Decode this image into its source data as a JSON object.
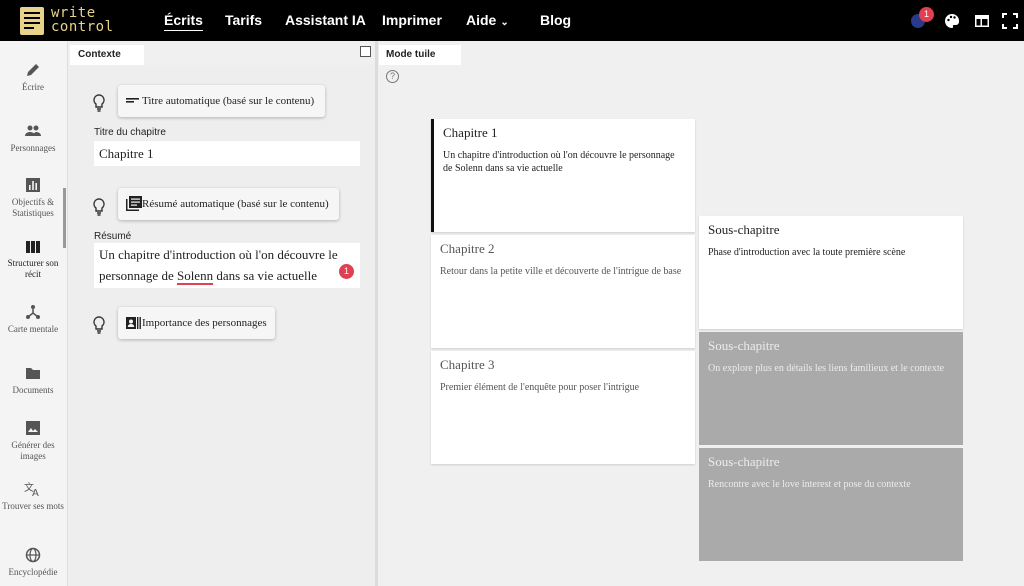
{
  "app": {
    "logo_line1": "write",
    "logo_line2": "control",
    "notification_count": "1"
  },
  "nav": [
    {
      "label": "Écrits"
    },
    {
      "label": "Tarifs"
    },
    {
      "label": "Assistant IA"
    },
    {
      "label": "Imprimer"
    },
    {
      "label": "Aide",
      "chevron": "chevron-down-icon"
    },
    {
      "label": "Blog"
    }
  ],
  "sidebar": {
    "items": [
      {
        "label": "Écrire",
        "icon": "pencil-icon"
      },
      {
        "label": "Personnages",
        "icon": "people-icon"
      },
      {
        "label": "Objectifs & Statistiques",
        "icon": "bar-chart-icon"
      },
      {
        "label": "Structurer son récit",
        "icon": "columns-icon"
      },
      {
        "label": "Carte mentale",
        "icon": "mind-map-icon"
      },
      {
        "label": "Documents",
        "icon": "folder-icon"
      },
      {
        "label": "Générer des images",
        "icon": "image-icon"
      },
      {
        "label": "Trouver ses mots",
        "icon": "translate-icon"
      },
      {
        "label": "Encyclopédie",
        "icon": "globe-icon"
      }
    ]
  },
  "context": {
    "tab_label": "Contexte",
    "auto_title_button": "Titre automatique (basé sur le contenu)",
    "title_label": "Titre du chapitre",
    "title_value": "Chapitre 1",
    "auto_summary_button": "Résumé automatique (basé sur le contenu)",
    "summary_label": "Résumé",
    "summary_part1": "Un chapitre d'introduction où l'on découvre le personnage de ",
    "summary_misspelled": "Solenn",
    "summary_part2": " dans sa vie actuelle",
    "summary_issue_count": "1",
    "characters_button": "Importance des personnages"
  },
  "tiles": {
    "tab_label": "Mode tuile",
    "help_icon": "?",
    "chapters": [
      {
        "title": "Chapitre 1",
        "desc": "Un chapitre d'introduction où l'on découvre le personnage de Solenn dans sa vie actuelle"
      },
      {
        "title": "Chapitre 2",
        "desc": "Retour dans la petite ville et découverte de l'intrigue de base"
      },
      {
        "title": "Chapitre 3",
        "desc": "Premier élément de l'enquête pour poser l'intrigue"
      }
    ],
    "subchapters": [
      {
        "title": "Sous-chapitre",
        "desc": "Phase d'introduction avec la toute première scène"
      },
      {
        "title": "Sous-chapitre",
        "desc": "On explore plus en détails les liens familieux et le contexte"
      },
      {
        "title": "Sous-chapitre",
        "desc": "Rencontre avec le love interest et pose du contexte"
      }
    ]
  },
  "colors": {
    "topbar": "#000000",
    "logo": "#e8d38a",
    "alert": "#e0404f",
    "dimmed_tile": "#aaaaaa"
  }
}
